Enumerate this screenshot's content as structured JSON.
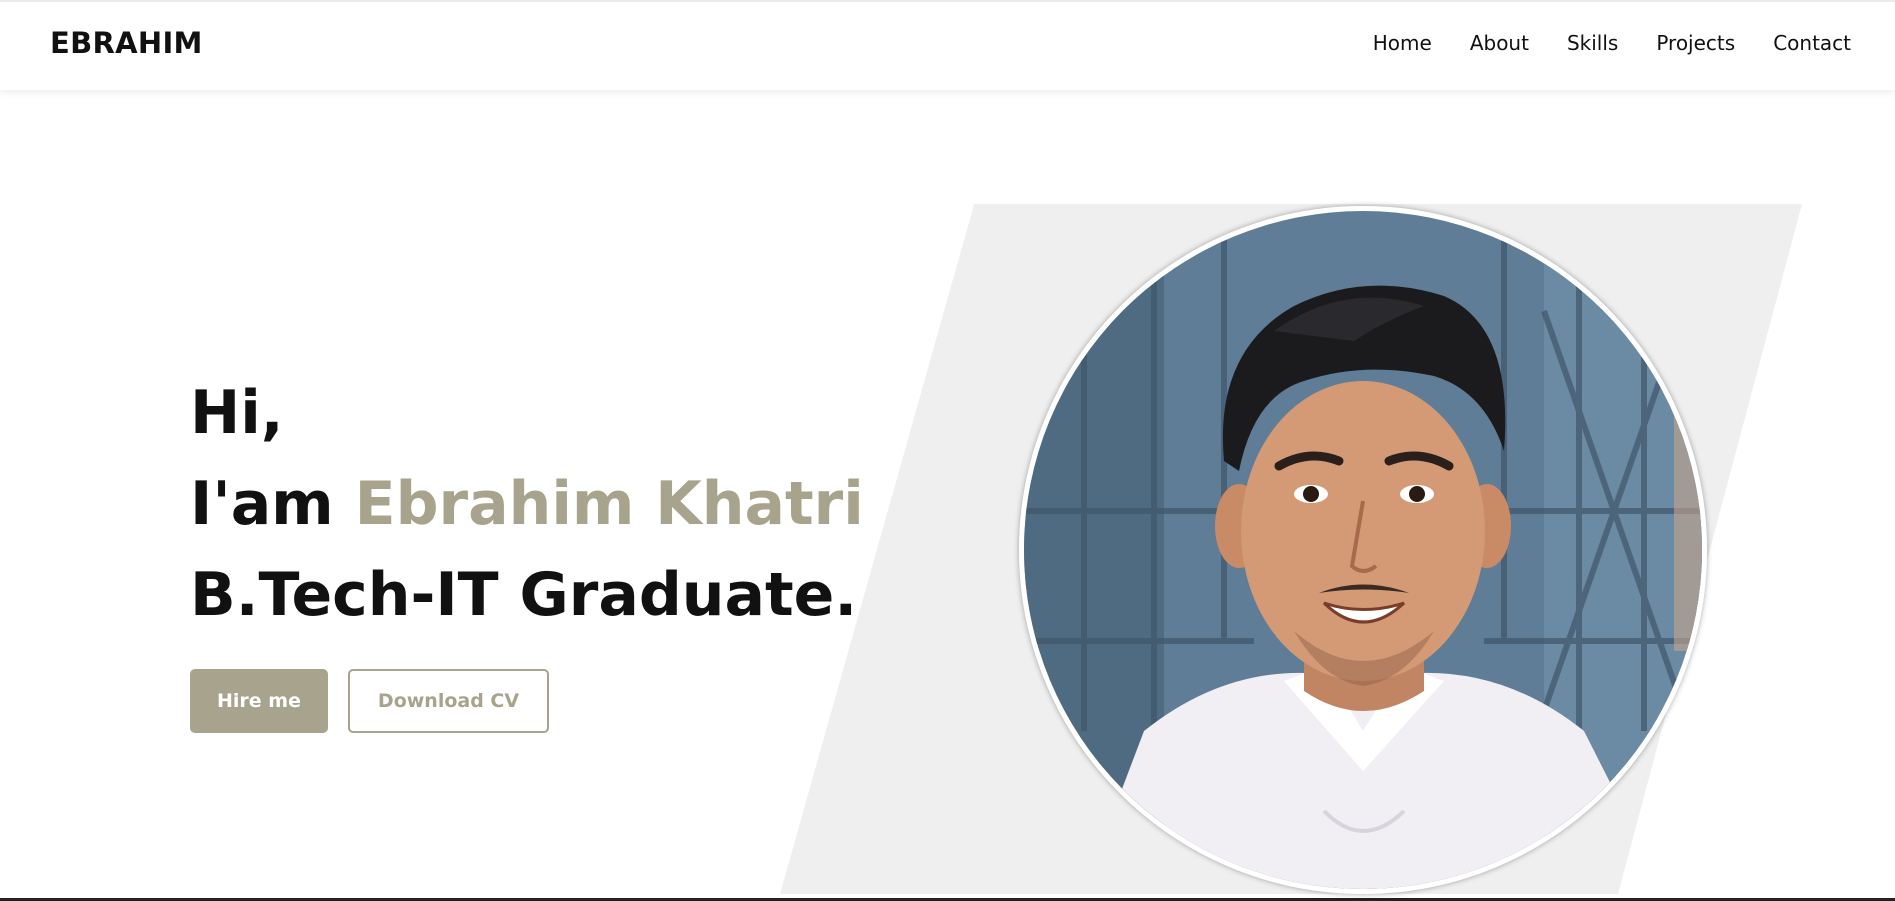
{
  "nav": {
    "logo": "EBRAHIM",
    "links": [
      "Home",
      "About",
      "Skills",
      "Projects",
      "Contact"
    ]
  },
  "hero": {
    "greeting": "Hi,",
    "intro_prefix": "I'am ",
    "name": "Ebrahim Khatri",
    "title": "B.Tech-IT Graduate.",
    "hire_button": "Hire me",
    "cv_button": "Download CV"
  },
  "colors": {
    "accent": "#a7a38c",
    "text": "#111111",
    "panel": "#efefef"
  }
}
